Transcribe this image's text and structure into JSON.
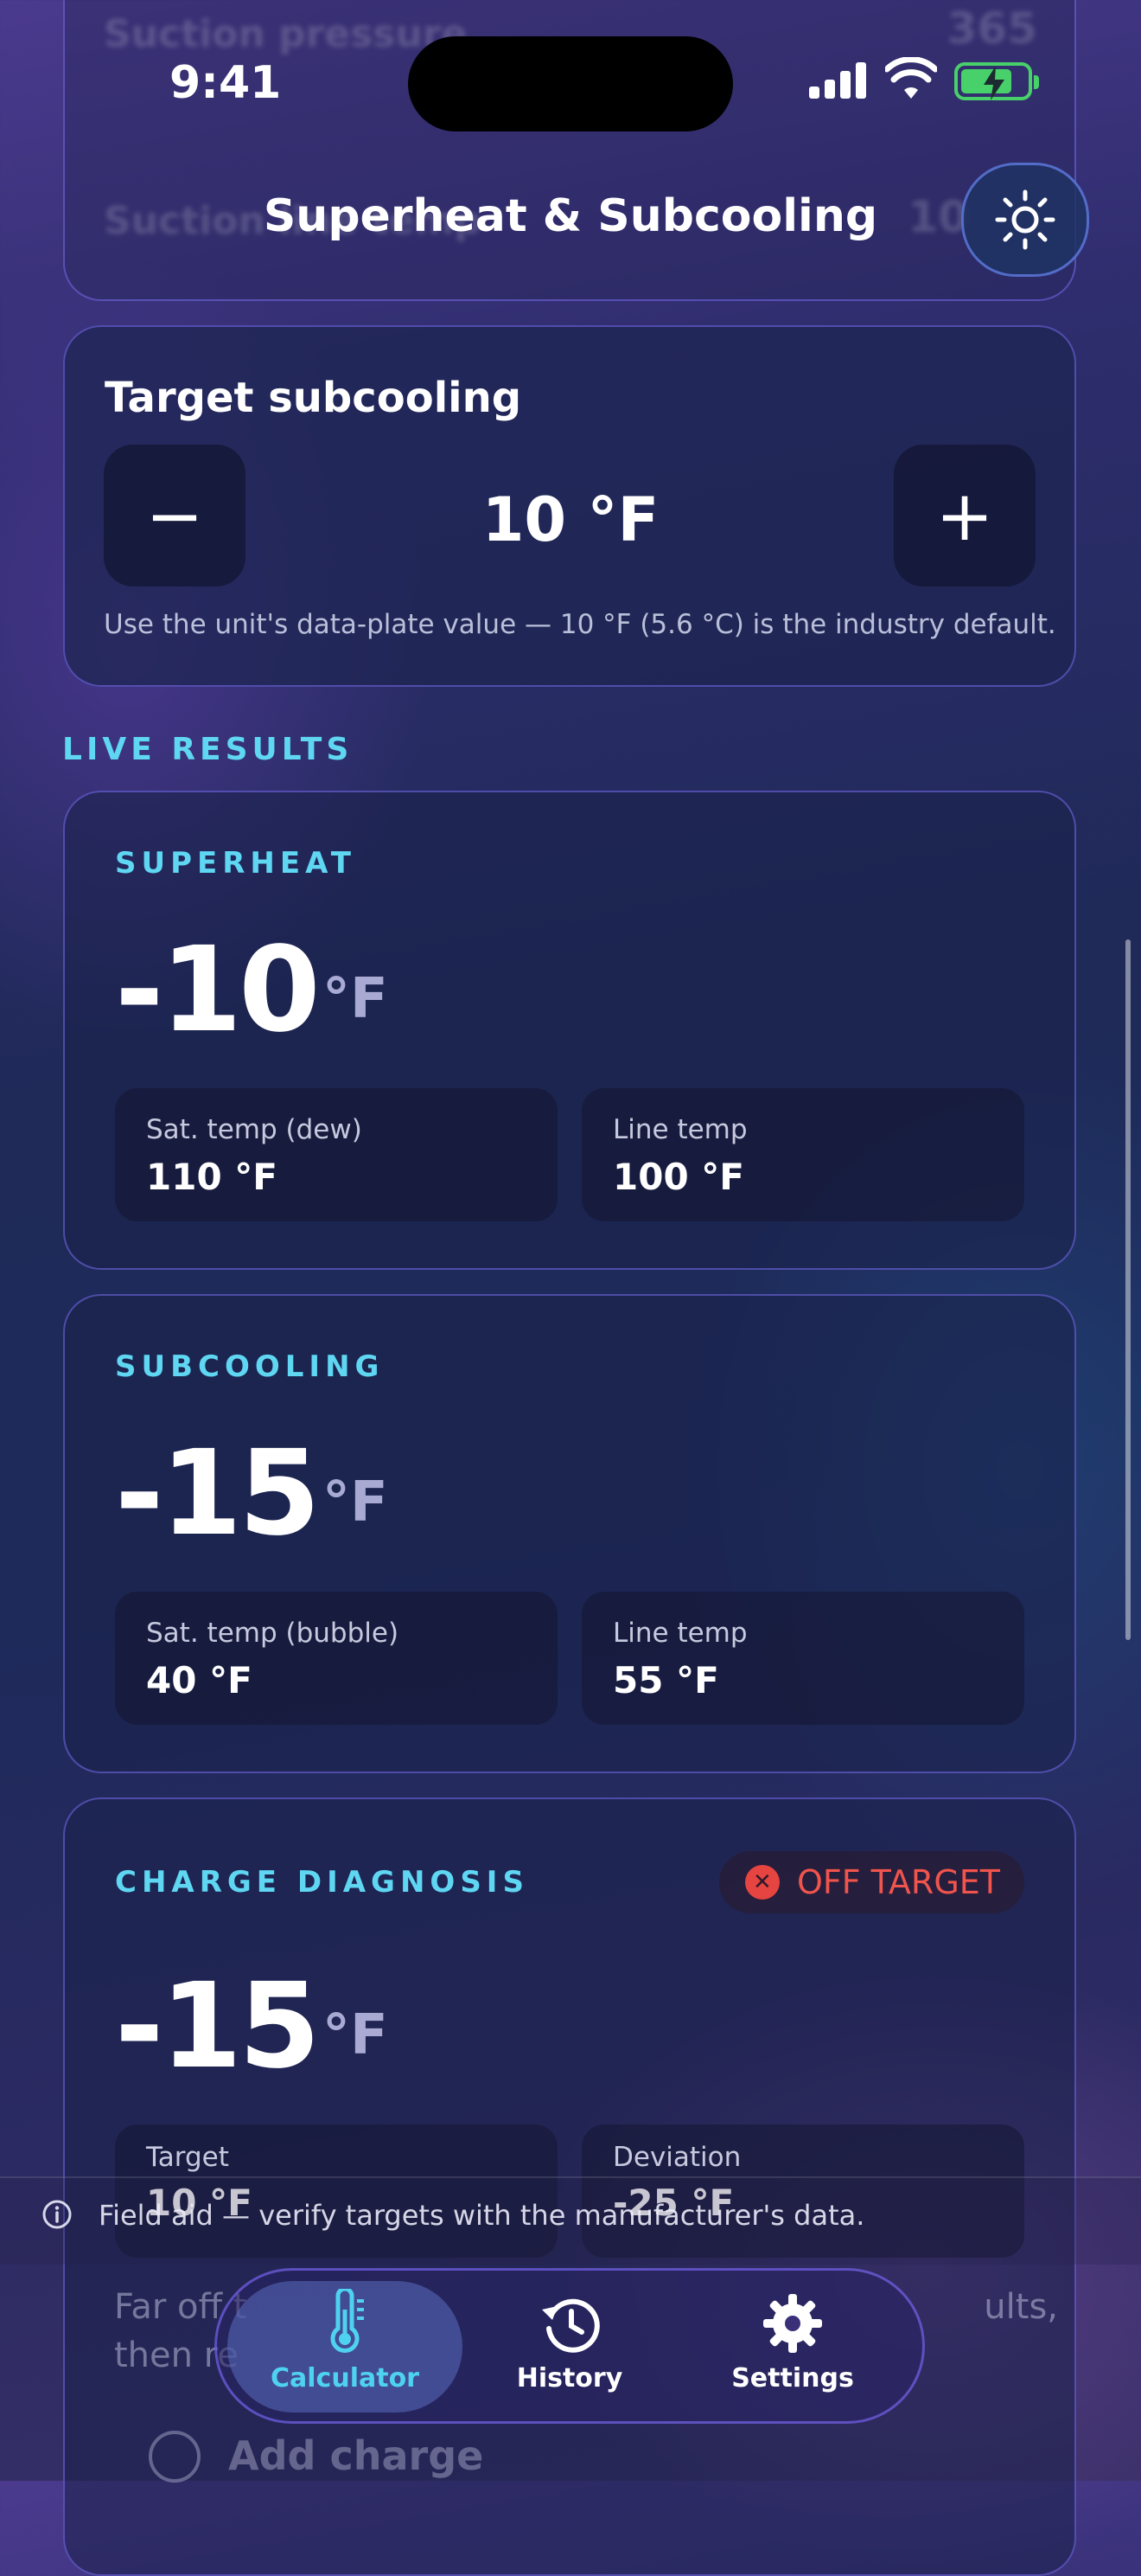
{
  "status_bar": {
    "time": "9:41"
  },
  "header": {
    "title": "Superheat & Subcooling",
    "ghost_rows": [
      {
        "label": "Suction pressure",
        "value": "365"
      },
      {
        "label": "Suction line temp",
        "value": "10"
      }
    ]
  },
  "target_subcooling": {
    "label": "Target subcooling",
    "minus_label": "−",
    "plus_label": "+",
    "value": "10 °F",
    "hint": "Use the unit's data-plate value — 10 °F (5.6 °C) is the industry default."
  },
  "live_results": {
    "section_title": "LIVE RESULTS",
    "superheat": {
      "title": "SUPERHEAT",
      "value": "-10",
      "unit": "°F",
      "sat_label": "Sat. temp (dew)",
      "sat_value": "110 °F",
      "line_label": "Line temp",
      "line_value": "100 °F"
    },
    "subcooling": {
      "title": "SUBCOOLING",
      "value": "-15",
      "unit": "°F",
      "sat_label": "Sat. temp (bubble)",
      "sat_value": "40 °F",
      "line_label": "Line temp",
      "line_value": "55 °F"
    },
    "diagnosis": {
      "title": "CHARGE DIAGNOSIS",
      "badge": "OFF TARGET",
      "badge_color": "#f0544d",
      "value": "-15",
      "unit": "°F",
      "target_label": "Target",
      "target_value": "10 °F",
      "deviation_label": "Deviation",
      "deviation_value": "-25 °F"
    }
  },
  "footer": {
    "notice": "Field aid — verify targets with the manufacturer's data.",
    "ghost_far": "Far off t",
    "ghost_then": "then re",
    "ghost_results": "ults,",
    "ghost_add": "Add charge"
  },
  "tabbar": {
    "tabs": [
      {
        "label": "Calculator",
        "icon": "thermometer-icon",
        "active": true
      },
      {
        "label": "History",
        "icon": "history-icon",
        "active": false
      },
      {
        "label": "Settings",
        "icon": "gear-icon",
        "active": false
      }
    ]
  },
  "colors": {
    "accent": "#5fd6f2",
    "warning": "#f0544d",
    "card_border": "#7a6ef0"
  }
}
